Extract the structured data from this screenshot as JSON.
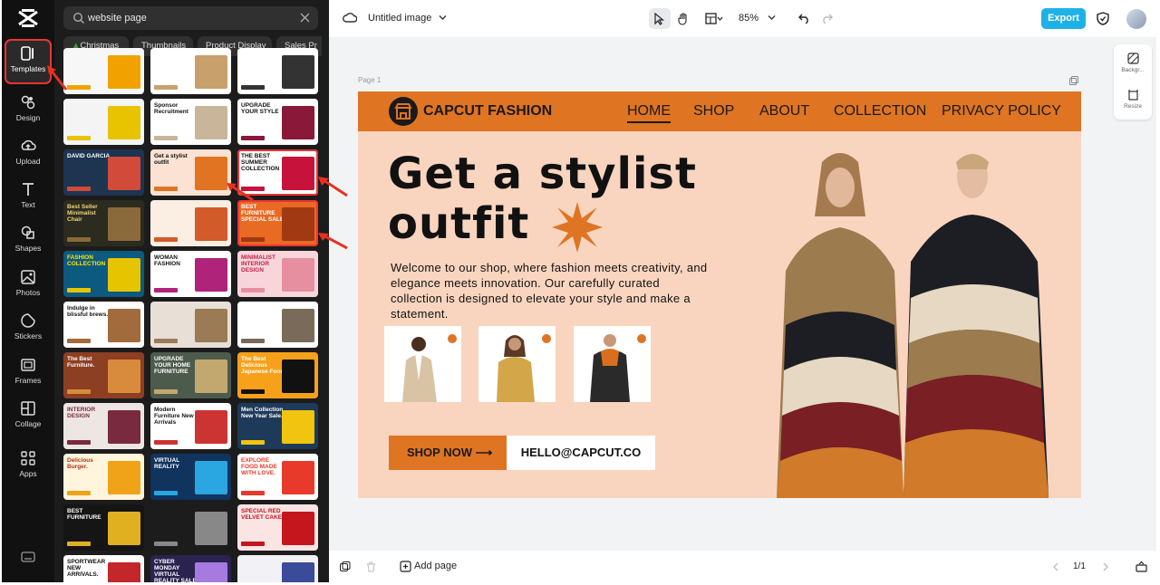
{
  "sidebar": {
    "items": [
      {
        "label": "Templates",
        "icon": "templates-icon"
      },
      {
        "label": "Design",
        "icon": "design-icon"
      },
      {
        "label": "Upload",
        "icon": "upload-icon"
      },
      {
        "label": "Text",
        "icon": "text-icon"
      },
      {
        "label": "Shapes",
        "icon": "shapes-icon"
      },
      {
        "label": "Photos",
        "icon": "photos-icon"
      },
      {
        "label": "Stickers",
        "icon": "stickers-icon"
      },
      {
        "label": "Frames",
        "icon": "frames-icon"
      },
      {
        "label": "Collage",
        "icon": "collage-icon"
      },
      {
        "label": "Apps",
        "icon": "apps-icon"
      }
    ]
  },
  "search": {
    "value": "website page"
  },
  "chips": [
    "Christmas",
    "Thumbnails",
    "Product Display",
    "Sales Pr"
  ],
  "thumbs": [
    {
      "bg": "#f7f7f7",
      "fg": "#111",
      "accent": "#f2a200",
      "title": ""
    },
    {
      "bg": "#ffffff",
      "fg": "#111",
      "accent": "#c7a06c",
      "title": ""
    },
    {
      "bg": "#ffffff",
      "fg": "#111",
      "accent": "#333333",
      "title": ""
    },
    {
      "bg": "#f4f4f4",
      "fg": "#111",
      "accent": "#e8c400",
      "title": ""
    },
    {
      "bg": "#ffffff",
      "fg": "#111",
      "accent": "#c9b59a",
      "title": "Sponsor Recruitment"
    },
    {
      "bg": "#ffffff",
      "fg": "#111",
      "accent": "#8a1838",
      "title": "UPGRADE YOUR STYLE"
    },
    {
      "bg": "#1d3550",
      "fg": "#ffffff",
      "accent": "#d24a3a",
      "title": "DAVID GARCIA"
    },
    {
      "bg": "#fbe2d3",
      "fg": "#111",
      "accent": "#e07422",
      "title": "Get a stylist outfit"
    },
    {
      "bg": "#ffffff",
      "fg": "#111",
      "accent": "#c7123c",
      "title": "THE BEST SUMMER COLLECTION"
    },
    {
      "bg": "#2b2b1f",
      "fg": "#f2d37a",
      "accent": "#8a6a3b",
      "title": "Best Seller Minimalist Chair"
    },
    {
      "bg": "#fbeee2",
      "fg": "#a3281f",
      "accent": "#d35a2a",
      "title": ""
    },
    {
      "bg": "#e86a23",
      "fg": "#ffffff",
      "accent": "#a13a12",
      "title": "BEST FURNITURE SPECIAL SALE"
    },
    {
      "bg": "#0d5a80",
      "fg": "#ffe600",
      "accent": "#e6c400",
      "title": "FASHION COLLECTION"
    },
    {
      "bg": "#ffffff",
      "fg": "#111",
      "accent": "#b0237a",
      "title": "WOMAN FASHION"
    },
    {
      "bg": "#f8d5da",
      "fg": "#c4224e",
      "accent": "#e68fa1",
      "title": "MINIMALIST INTERIOR DESIGN"
    },
    {
      "bg": "#ffffff",
      "fg": "#111",
      "accent": "#a26b3c",
      "title": "Indulge in blissful brews."
    },
    {
      "bg": "#e8dfd6",
      "fg": "#111",
      "accent": "#9b7a56",
      "title": ""
    },
    {
      "bg": "#ffffff",
      "fg": "#111",
      "accent": "#7a6a5a",
      "title": ""
    },
    {
      "bg": "#8d3f23",
      "fg": "#ffffff",
      "accent": "#d88b3c",
      "title": "The Best Furniture."
    },
    {
      "bg": "#4d5b4c",
      "fg": "#ffffff",
      "accent": "#c2a86f",
      "title": "UPGRADE YOUR HOME FURNITURE"
    },
    {
      "bg": "#f7a11b",
      "fg": "#ffffff",
      "accent": "#111111",
      "title": "The Best Delicious Japanese Food"
    },
    {
      "bg": "#ede6e3",
      "fg": "#7a2a3e",
      "accent": "#7a2a3e",
      "title": "INTERIOR DESIGN"
    },
    {
      "bg": "#ffffff",
      "fg": "#111",
      "accent": "#c33",
      "title": "Modern Furniture New Arrivals"
    },
    {
      "bg": "#1e3a5a",
      "fg": "#ffffff",
      "accent": "#f1c40f",
      "title": "Men Collection New Year Sale."
    },
    {
      "bg": "#fff4dc",
      "fg": "#b3321f",
      "accent": "#f0a319",
      "title": "Delicious Burger."
    },
    {
      "bg": "#10345e",
      "fg": "#ffffff",
      "accent": "#2aa6e0",
      "title": "VIRTUAL REALITY"
    },
    {
      "bg": "#ffffff",
      "fg": "#e83a2b",
      "accent": "#e83a2b",
      "title": "EXPLORE FOOD MADE WITH LOVE."
    },
    {
      "bg": "#151515",
      "fg": "#ffffff",
      "accent": "#e0b020",
      "title": "BEST FURNITURE"
    },
    {
      "bg": "#1c1c1c",
      "fg": "#ffffff",
      "accent": "#888888",
      "title": ""
    },
    {
      "bg": "#fbe4e4",
      "fg": "#c4161c",
      "accent": "#c4161c",
      "title": "SPECIAL RED VELVET CAKE"
    },
    {
      "bg": "#ffffff",
      "fg": "#111",
      "accent": "#c3262b",
      "title": "SPORTWEAR NEW ARRIVALS."
    },
    {
      "bg": "#2a2350",
      "fg": "#ffffff",
      "accent": "#a77ae0",
      "title": "CYBER MONDAY VIRTUAL REALITY SALE"
    },
    {
      "bg": "#f1f1f6",
      "fg": "#111",
      "accent": "#3a4b9a",
      "title": ""
    }
  ],
  "topbar": {
    "title": "Untitled image",
    "zoom": "85%",
    "export": "Export"
  },
  "sidetools": {
    "background": "Backgr...",
    "resize": "Resize"
  },
  "canvas": {
    "page_label": "Page 1",
    "brand": "CAPCUT FASHION",
    "nav": [
      "HOME",
      "SHOP",
      "ABOUT",
      "COLLECTION",
      "PRIVACY POLICY"
    ],
    "headline_line1": "Get a stylist",
    "headline_line2": "outfit",
    "body": "Welcome to our shop, where fashion meets creativity, and elegance meets innovation. Our carefully curated collection is designed to elevate your style and make a statement.",
    "shop_now": "SHOP NOW",
    "email": "HELLO@CAPCUT.CO",
    "colors": {
      "accent": "#df7423",
      "background": "#f9d5bf"
    }
  },
  "bottombar": {
    "add_page": "Add page",
    "pager": "1/1"
  }
}
